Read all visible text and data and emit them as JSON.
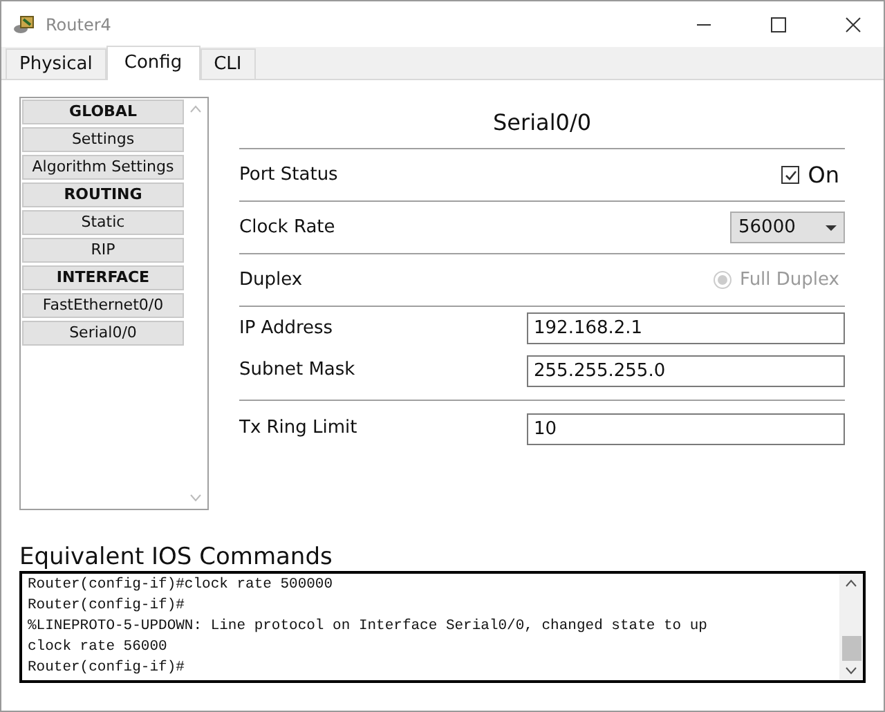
{
  "window": {
    "title": "Router4"
  },
  "tabs": [
    {
      "label": "Physical",
      "selected": false
    },
    {
      "label": "Config",
      "selected": true
    },
    {
      "label": "CLI",
      "selected": false
    }
  ],
  "sidebar": {
    "items": [
      {
        "label": "GLOBAL",
        "kind": "header"
      },
      {
        "label": "Settings",
        "kind": "item"
      },
      {
        "label": "Algorithm Settings",
        "kind": "item"
      },
      {
        "label": "ROUTING",
        "kind": "header"
      },
      {
        "label": "Static",
        "kind": "item"
      },
      {
        "label": "RIP",
        "kind": "item"
      },
      {
        "label": "INTERFACE",
        "kind": "header"
      },
      {
        "label": "FastEthernet0/0",
        "kind": "item"
      },
      {
        "label": "Serial0/0",
        "kind": "item"
      }
    ]
  },
  "panel": {
    "title": "Serial0/0",
    "port_status": {
      "label": "Port Status",
      "option": "On",
      "checked": true
    },
    "clock_rate": {
      "label": "Clock Rate",
      "value": "56000"
    },
    "duplex": {
      "label": "Duplex",
      "option": "Full Duplex",
      "selected": true,
      "disabled": true
    },
    "ip_address": {
      "label": "IP Address",
      "value": "192.168.2.1"
    },
    "subnet_mask": {
      "label": "Subnet Mask",
      "value": "255.255.255.0"
    },
    "tx_ring_limit": {
      "label": "Tx Ring Limit",
      "value": "10"
    }
  },
  "console": {
    "title": "Equivalent IOS Commands",
    "lines": [
      "Router(config-if)#clock rate 500000",
      "Router(config-if)#",
      "%LINEPROTO-5-UPDOWN: Line protocol on Interface Serial0/0, changed state to up",
      "clock rate 56000",
      "Router(config-if)#"
    ]
  }
}
